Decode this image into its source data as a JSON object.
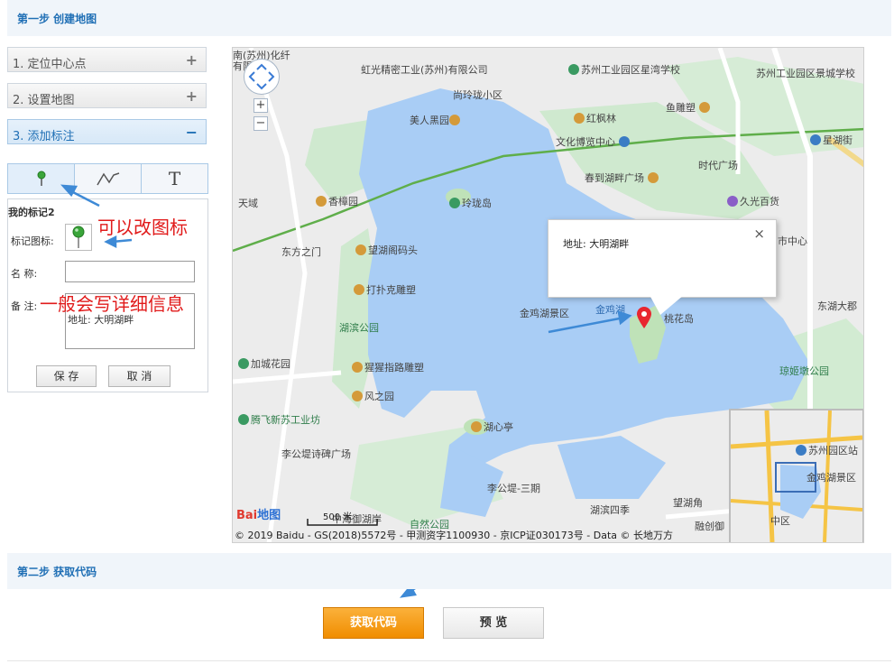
{
  "step1": {
    "title": "第一步 创建地图"
  },
  "step2": {
    "title": "第二步 获取代码"
  },
  "accordion": [
    {
      "label": "1. 定位中心点",
      "toggle": "+"
    },
    {
      "label": "2. 设置地图",
      "toggle": "+"
    },
    {
      "label": "3. 添加标注",
      "toggle": "−"
    }
  ],
  "tools": [
    {
      "name": "marker",
      "icon": "map-pin-icon"
    },
    {
      "name": "polyline",
      "icon": "polyline-icon"
    },
    {
      "name": "text",
      "icon": "T"
    }
  ],
  "marker_panel": {
    "title": "我的标记2",
    "icon_label": "标记图标:",
    "name_label": "名 称:",
    "name_value": "",
    "note_label": "备 注:",
    "note_value": "地址: 大明湖畔",
    "save": "保 存",
    "cancel": "取 消"
  },
  "annotations": {
    "change_icon": "可以改图标",
    "detail_info": "一般会写详细信息"
  },
  "map": {
    "popup_text": "地址: 大明湖畔",
    "popup_close": "×",
    "zoom_in": "+",
    "zoom_out": "−",
    "scale": "500 米",
    "logo": "Bai地图",
    "copyright": "© 2019 Baidu - GS(2018)5572号 - 甲测资字1100930 - 京ICP证030173号 - Data © 长地万方",
    "labels": [
      "苏州工业园区星湾学校",
      "苏州工业园区景城学校",
      "虹光精密工业(苏州)有限公司",
      "尚玲珑小区",
      "美人黑园",
      "红枫林",
      "鱼雕塑",
      "文化博览中心",
      "星湖街",
      "时代广场",
      "春到湖畔广场",
      "天域",
      "香樟园",
      "玲珑岛",
      "久光百货",
      "东方之门",
      "望湖阁码头",
      "打扑克雕塑",
      "金鸡湖景区",
      "金鸡湖",
      "桃花岛",
      "湖滨公园",
      "加城花园",
      "猩猩指路雕塑",
      "风之园",
      "腾飞新苏工业坊",
      "湖心亭",
      "李公堤诗碑广场",
      "李公堤-三期",
      "湖滨四季",
      "望湖角",
      "自然公园",
      "中海御湖岸",
      "融创御",
      "琼姬墩公园",
      "东湖大郡",
      "市中心",
      "苏州园区站",
      "金鸡湖景区",
      "中区",
      "南"
    ]
  },
  "buttons": {
    "get_code": "获取代码",
    "preview": "预 览"
  },
  "colors": {
    "accent_blue": "#1f6fb5",
    "lake": "#a9cdf5",
    "park": "#c9e8c9",
    "annotation_red": "#e11b1b",
    "arrow_blue": "#3e8ad6",
    "marker_red": "#e8262f",
    "get_code_orange": "#f39a13"
  }
}
